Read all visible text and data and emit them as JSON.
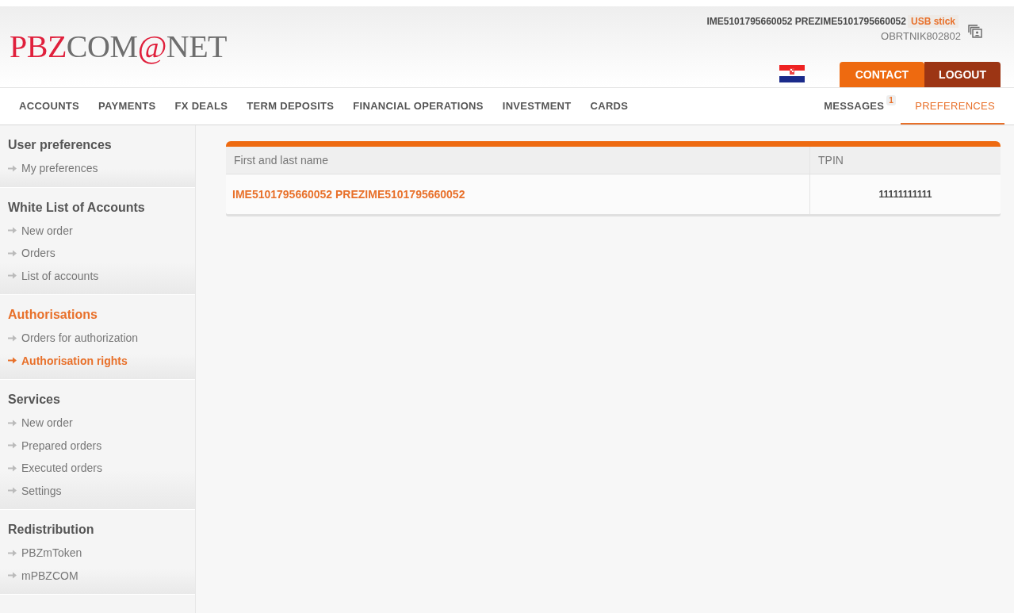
{
  "logo": [
    {
      "text": "PBZ",
      "kind": "accent"
    },
    {
      "text": "COM",
      "kind": "plain"
    },
    {
      "text": "@",
      "kind": "at"
    },
    {
      "text": "NET",
      "kind": "plain"
    }
  ],
  "user": {
    "name": "IME5101795660052 PREZIME5101795660052",
    "method": "USB stick",
    "company": "OBRTNIK802802"
  },
  "header_buttons": [
    {
      "label": "CONTACT",
      "kind": "contact"
    },
    {
      "label": "LOGOUT",
      "kind": "logout"
    }
  ],
  "nav": [
    {
      "label": "ACCOUNTS",
      "selected": false
    },
    {
      "label": "PAYMENTS",
      "selected": false
    },
    {
      "label": "FX DEALS",
      "selected": false
    },
    {
      "label": "TERM DEPOSITS",
      "selected": false
    },
    {
      "label": "FINANCIAL OPERATIONS",
      "selected": false
    },
    {
      "label": "INVESTMENT",
      "selected": false
    },
    {
      "label": "CARDS",
      "selected": false
    }
  ],
  "nav_right": [
    {
      "label": "MESSAGES",
      "badge": "1",
      "selected": false
    },
    {
      "label": "PREFERENCES",
      "selected": true
    }
  ],
  "sidebar": [
    {
      "title": "User preferences",
      "selected": false,
      "items": [
        {
          "label": "My preferences",
          "selected": false
        }
      ]
    },
    {
      "title": "White List of Accounts",
      "selected": false,
      "items": [
        {
          "label": "New order",
          "selected": false
        },
        {
          "label": "Orders",
          "selected": false
        },
        {
          "label": "List of accounts",
          "selected": false
        }
      ]
    },
    {
      "title": "Authorisations",
      "selected": true,
      "items": [
        {
          "label": "Orders for authorization",
          "selected": false
        },
        {
          "label": "Authorisation rights",
          "selected": true
        }
      ]
    },
    {
      "title": "Services",
      "selected": false,
      "items": [
        {
          "label": "New order",
          "selected": false
        },
        {
          "label": "Prepared orders",
          "selected": false
        },
        {
          "label": "Executed orders",
          "selected": false
        },
        {
          "label": "Settings",
          "selected": false
        }
      ]
    },
    {
      "title": "Redistribution",
      "selected": false,
      "items": [
        {
          "label": "PBZmToken",
          "selected": false
        },
        {
          "label": "mPBZCOM",
          "selected": false
        }
      ]
    }
  ],
  "table": {
    "columns": [
      "First and last name",
      "TPIN"
    ],
    "rows": [
      [
        "IME5101795660052 PREZIME5101795660052",
        "11111111111"
      ]
    ]
  }
}
